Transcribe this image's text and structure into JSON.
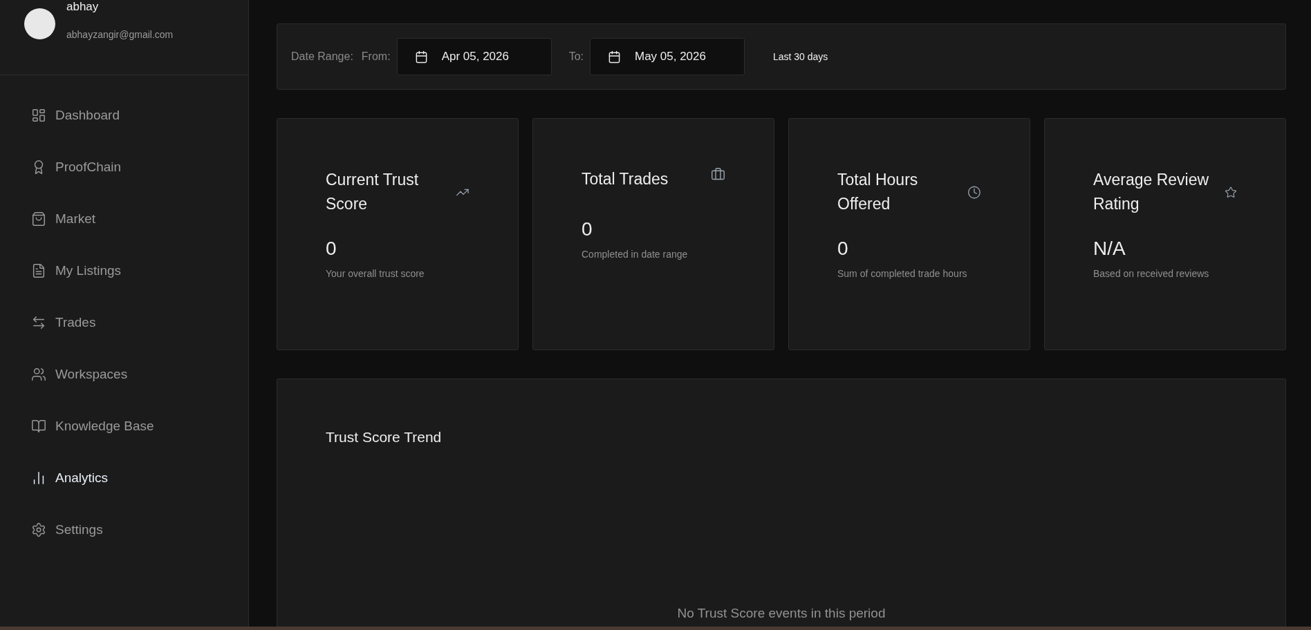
{
  "user": {
    "name": "abhay",
    "email": "abhayzangir@gmail.com"
  },
  "sidebar": {
    "items": [
      {
        "label": "Dashboard",
        "selected": false
      },
      {
        "label": "ProofChain",
        "selected": false
      },
      {
        "label": "Market",
        "selected": false
      },
      {
        "label": "My Listings",
        "selected": false
      },
      {
        "label": "Trades",
        "selected": false
      },
      {
        "label": "Workspaces",
        "selected": false
      },
      {
        "label": "Knowledge Base",
        "selected": false
      },
      {
        "label": "Analytics",
        "selected": true
      },
      {
        "label": "Settings",
        "selected": false
      }
    ]
  },
  "date_range": {
    "label": "Date Range:",
    "from_label": "From:",
    "from": "Apr 05, 2026",
    "to_label": "To:",
    "to": "May 05, 2026",
    "preset": "Last 30 days"
  },
  "cards": [
    {
      "title": "Current Trust Score",
      "value": "0",
      "caption": "Your overall trust score"
    },
    {
      "title": "Total Trades",
      "value": "0",
      "caption": "Completed in date range"
    },
    {
      "title": "Total Hours Offered",
      "value": "0",
      "caption": "Sum of completed trade hours"
    },
    {
      "title": "Average Review Rating",
      "value": "N/A",
      "caption": "Based on received reviews"
    }
  ],
  "trend": {
    "title": "Trust Score Trend",
    "empty_message": "No Trust Score events in this period"
  }
}
